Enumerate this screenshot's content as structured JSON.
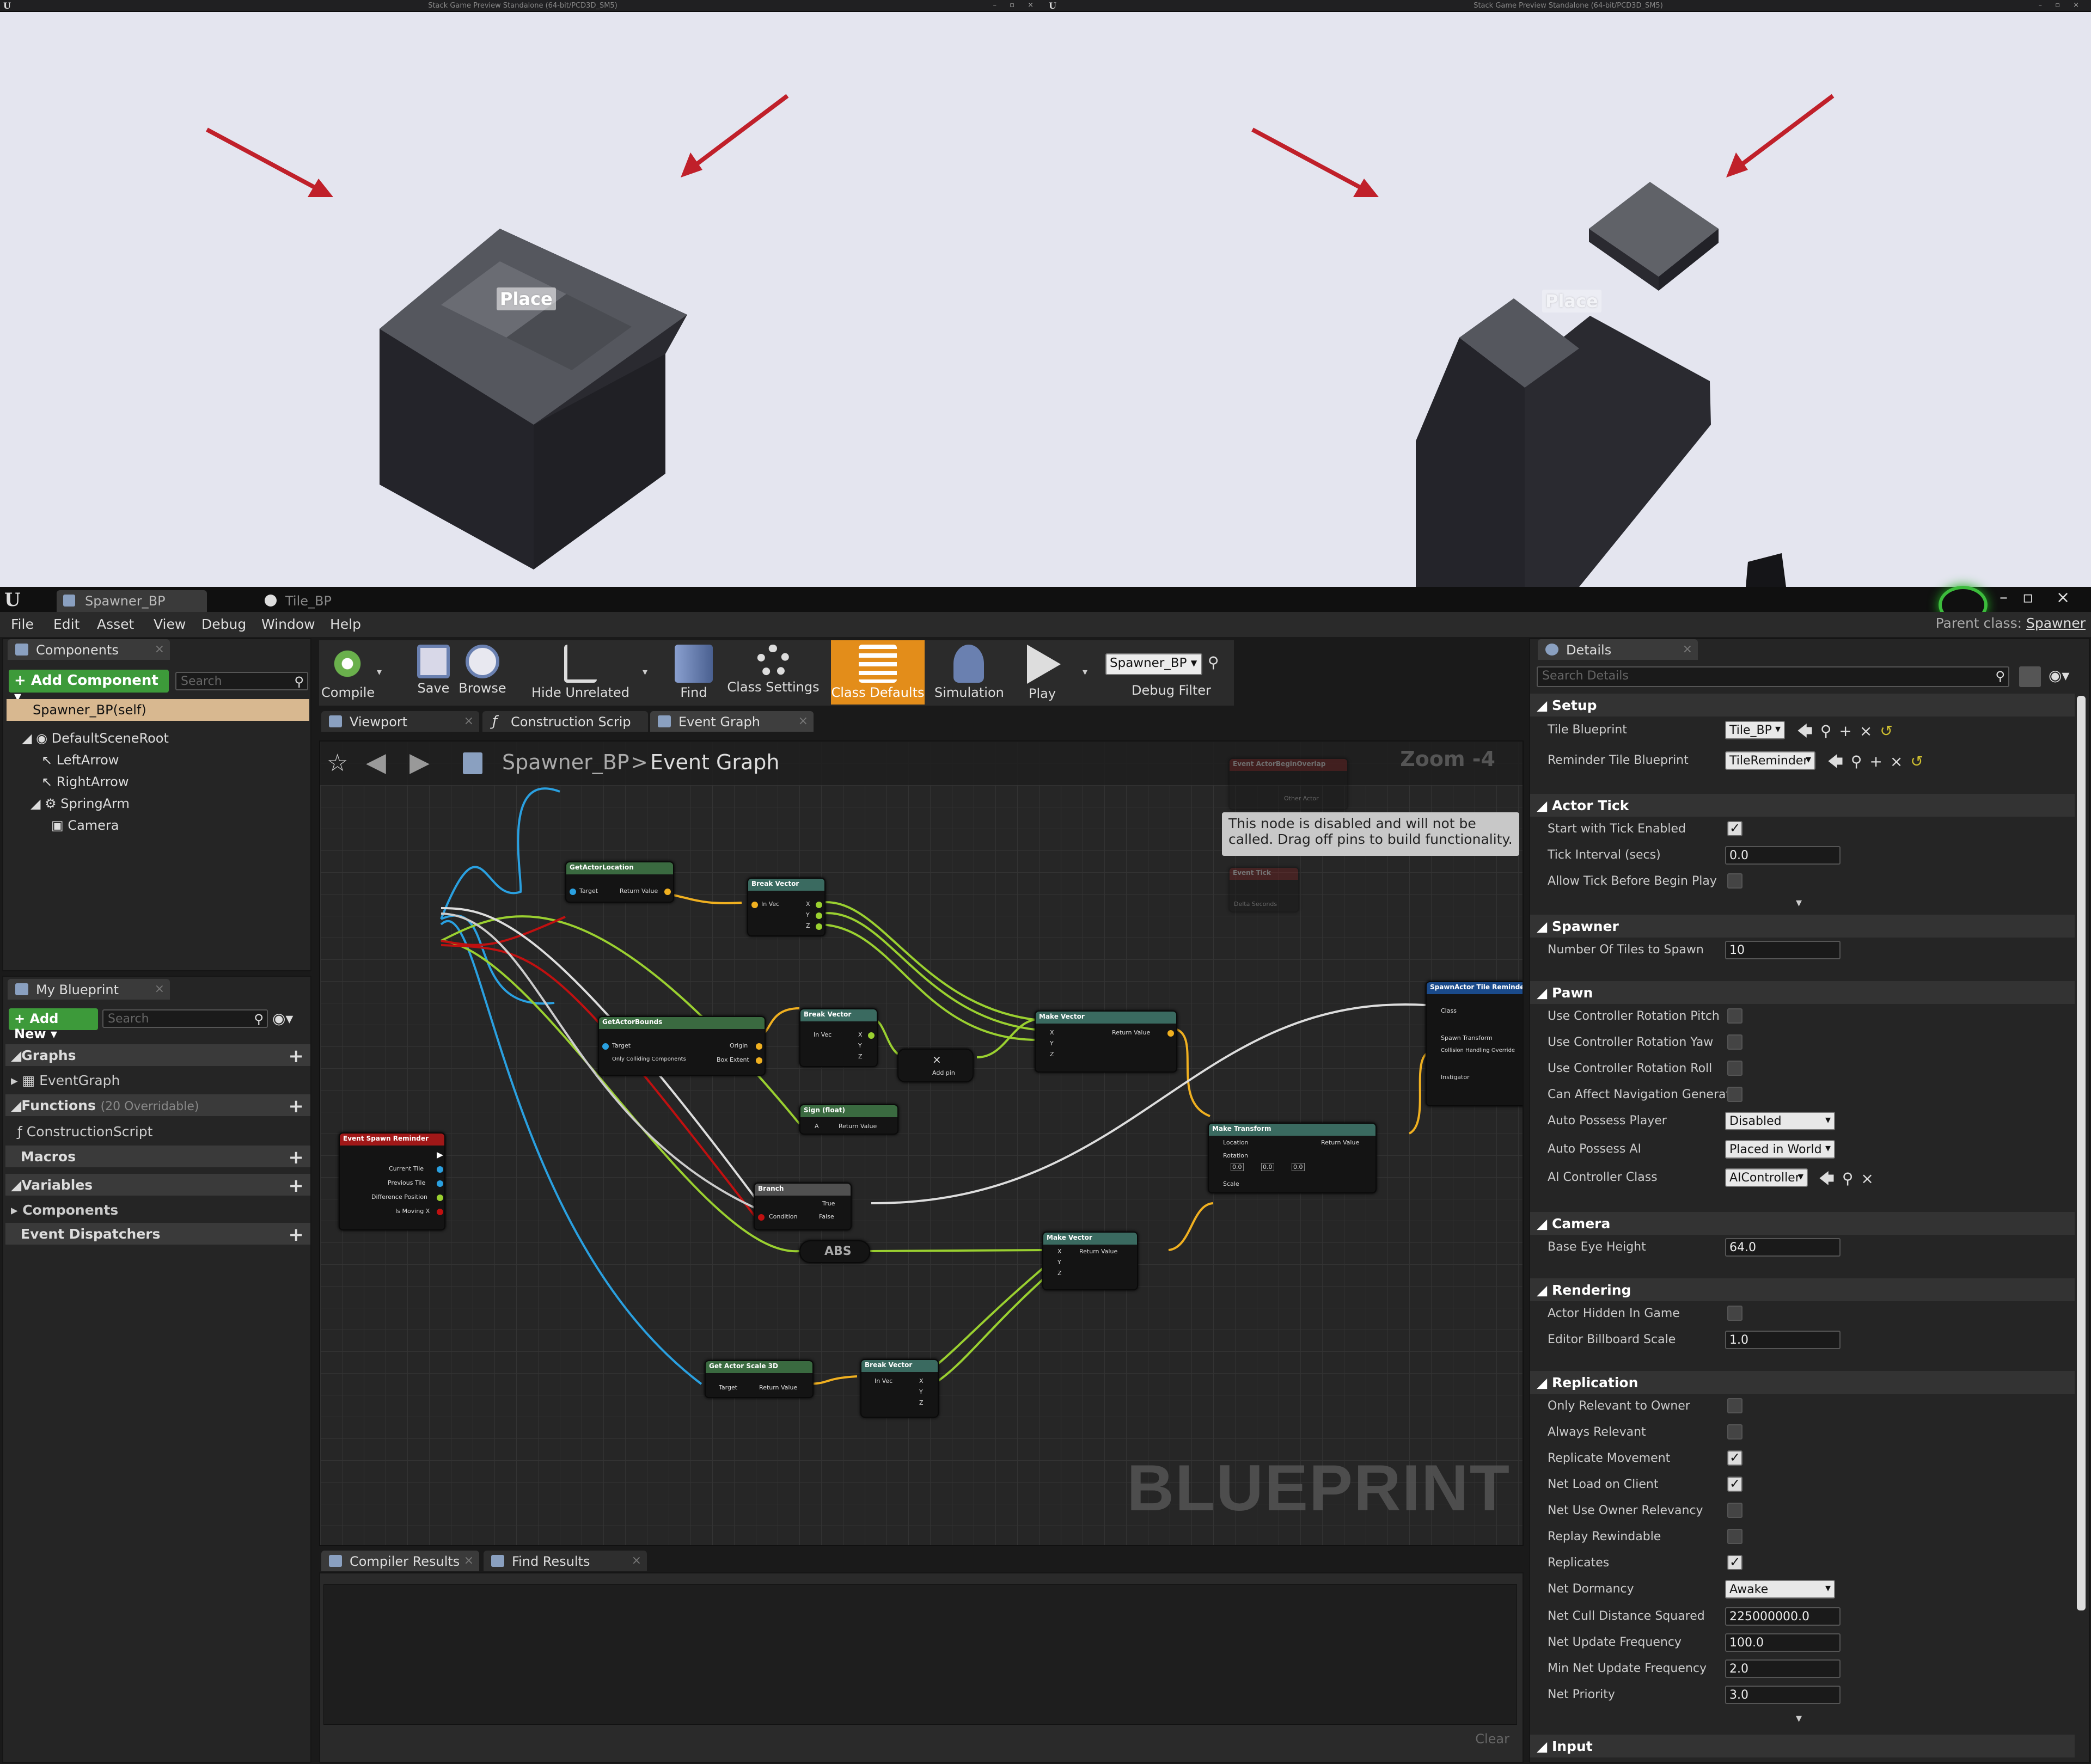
{
  "left_preview": {
    "title": "Stack Game Preview Standalone (64-bit/PCD3D_SM5)",
    "place_label": "Place"
  },
  "right_preview": {
    "title": "Stack Game Preview Standalone (64-bit/PCD3D_SM5)",
    "place_label": "Place"
  },
  "editor_tabs": [
    {
      "label": "Spawner_BP"
    },
    {
      "label": "Tile_BP"
    }
  ],
  "menu": [
    "File",
    "Edit",
    "Asset",
    "View",
    "Debug",
    "Window",
    "Help"
  ],
  "parent_class": {
    "label": "Parent class:",
    "value": "Spawner"
  },
  "components_panel": {
    "tab": "Components",
    "add_component": "+ Add Component ▾",
    "search_placeholder": "Search",
    "self_item": "Spawner_BP(self)",
    "tree": [
      "DefaultSceneRoot",
      "LeftArrow",
      "RightArrow",
      "SpringArm",
      "Camera"
    ]
  },
  "my_blueprint_panel": {
    "tab": "My Blueprint",
    "add_new": "+ Add New ▾",
    "search_placeholder": "Search",
    "graphs": "Graphs",
    "event_graph": "EventGraph",
    "functions": "Functions",
    "functions_count": "(20 Overridable)",
    "construction_script": "ConstructionScript",
    "macros": "Macros",
    "variables": "Variables",
    "components": "Components",
    "event_dispatchers": "Event Dispatchers"
  },
  "toolbar": {
    "compile": "Compile",
    "save": "Save",
    "browse": "Browse",
    "hide_unrelated": "Hide Unrelated",
    "find": "Find",
    "class_settings": "Class Settings",
    "class_defaults": "Class Defaults",
    "simulation": "Simulation",
    "play": "Play",
    "debug_combo": "Spawner_BP ▾",
    "debug_filter": "Debug Filter"
  },
  "doc_tabs": [
    {
      "label": "Viewport"
    },
    {
      "label": "Construction Scrip"
    },
    {
      "label": "Event Graph"
    }
  ],
  "graph": {
    "breadcrumb_root": "Spawner_BP",
    "breadcrumb_sep": ">",
    "breadcrumb_current": "Event Graph",
    "zoom": "Zoom -4",
    "watermark": "BLUEPRINT",
    "disabled_tip": "This node is disabled and will not be called. Drag off pins to build functionality.",
    "nodes": {
      "get_actor_location": "GetActorLocation",
      "break_vector_1": "Break Vector",
      "get_actor_bounds": "GetActorBounds",
      "break_vector_2": "Break Vector",
      "make_vector_1": "Make Vector",
      "event_spawn_reminder": "Event Spawn Reminder",
      "sign_float": "Sign (float)",
      "branch": "Branch",
      "abs": "ABS",
      "make_vector_2": "Make Vector",
      "make_transform": "Make Transform",
      "spawn_actor": "SpawnActor Tile Reminder",
      "get_actor_scale": "Get Actor Scale 3D",
      "break_vector_3": "Break Vector",
      "event_tick": "Event Tick",
      "event_actor_begin_overlap": "Event ActorBeginOverlap"
    },
    "pins": {
      "target": "Target",
      "return_value": "Return Value",
      "in_vec": "In Vec",
      "x": "X",
      "y": "Y",
      "z": "Z",
      "origin": "Origin",
      "box_extent": "Box Extent",
      "only_colliding": "Only Colliding Components",
      "current_tile": "Current Tile",
      "previous_tile": "Previous Tile",
      "difference_position": "Difference Position",
      "is_moving_x": "Is Moving X",
      "a": "A",
      "true": "True",
      "false": "False",
      "condition": "Condition",
      "location": "Location",
      "rotation": "Rotation",
      "scale": "Scale",
      "add_pin": "Add pin",
      "class": "Class",
      "spawn_transform": "Spawn Transform",
      "collision_handling": "Collision Handling Override",
      "instigator": "Instigator",
      "other_actor": "Other Actor",
      "delta_seconds": "Delta Seconds",
      "zero": "0.0"
    }
  },
  "bottom_tabs": [
    {
      "label": "Compiler Results"
    },
    {
      "label": "Find Results"
    }
  ],
  "clear_label": "Clear",
  "details": {
    "tab": "Details",
    "search_placeholder": "Search Details",
    "sections": {
      "setup": "Setup",
      "actor_tick": "Actor Tick",
      "spawner": "Spawner",
      "pawn": "Pawn",
      "camera": "Camera",
      "rendering": "Rendering",
      "replication": "Replication",
      "input": "Input"
    },
    "rows": {
      "tile_blueprint": {
        "label": "Tile Blueprint",
        "value": "Tile_BP"
      },
      "reminder_tile_blueprint": {
        "label": "Reminder Tile Blueprint",
        "value": "TileReminder"
      },
      "start_with_tick": {
        "label": "Start with Tick Enabled"
      },
      "tick_interval": {
        "label": "Tick Interval (secs)",
        "value": "0.0"
      },
      "allow_tick_before": {
        "label": "Allow Tick Before Begin Play"
      },
      "number_of_tiles": {
        "label": "Number Of Tiles to Spawn",
        "value": "10"
      },
      "use_ctrl_pitch": {
        "label": "Use Controller Rotation Pitch"
      },
      "use_ctrl_yaw": {
        "label": "Use Controller Rotation Yaw"
      },
      "use_ctrl_roll": {
        "label": "Use Controller Rotation Roll"
      },
      "can_affect_nav": {
        "label": "Can Affect Navigation Generati"
      },
      "auto_possess_player": {
        "label": "Auto Possess Player",
        "value": "Disabled"
      },
      "auto_possess_ai": {
        "label": "Auto Possess AI",
        "value": "Placed in World"
      },
      "ai_controller_class": {
        "label": "AI Controller Class",
        "value": "AIController"
      },
      "base_eye_height": {
        "label": "Base Eye Height",
        "value": "64.0"
      },
      "actor_hidden": {
        "label": "Actor Hidden In Game"
      },
      "editor_billboard": {
        "label": "Editor Billboard Scale",
        "value": "1.0"
      },
      "only_relevant_owner": {
        "label": "Only Relevant to Owner"
      },
      "always_relevant": {
        "label": "Always Relevant"
      },
      "replicate_movement": {
        "label": "Replicate Movement"
      },
      "net_load_on_client": {
        "label": "Net Load on Client"
      },
      "net_use_owner": {
        "label": "Net Use Owner Relevancy"
      },
      "replay_rewindable": {
        "label": "Replay Rewindable"
      },
      "replicates": {
        "label": "Replicates"
      },
      "net_dormancy": {
        "label": "Net Dormancy",
        "value": "Awake"
      },
      "net_cull": {
        "label": "Net Cull Distance Squared",
        "value": "225000000.0"
      },
      "net_update_freq": {
        "label": "Net Update Frequency",
        "value": "100.0"
      },
      "min_net_update": {
        "label": "Min Net Update Frequency",
        "value": "2.0"
      },
      "net_priority": {
        "label": "Net Priority",
        "value": "3.0"
      }
    }
  },
  "colors": {
    "class_defaults_highlight": "#e38d1a",
    "add_component_green": "#3d9a3a",
    "arrow_red": "#c0202a",
    "exec_white": "#ffffff",
    "vector_yellow": "#f0b020",
    "float_green": "#9ad030",
    "object_blue": "#2aa0e0",
    "bool_red": "#c01010"
  }
}
